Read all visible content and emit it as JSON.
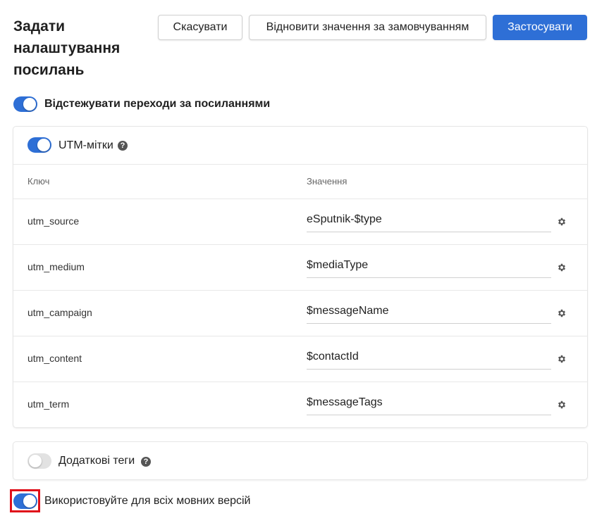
{
  "header": {
    "title": "Задати налаштування посилань",
    "buttons": {
      "cancel": "Скасувати",
      "restore_defaults": "Відновити значення за замовчуванням",
      "apply": "Застосувати"
    }
  },
  "track_clicks": {
    "label": "Відстежувати переходи за посиланнями",
    "enabled": true
  },
  "utm_section": {
    "label": "UTM-мітки",
    "enabled": true,
    "help_icon": "question-circle-icon",
    "columns": {
      "key": "Ключ",
      "value": "Значення"
    },
    "rows": [
      {
        "key": "utm_source",
        "value": "eSputnik-$type"
      },
      {
        "key": "utm_medium",
        "value": "$mediaType"
      },
      {
        "key": "utm_campaign",
        "value": "$messageName"
      },
      {
        "key": "utm_content",
        "value": "$contactId"
      },
      {
        "key": "utm_term",
        "value": "$messageTags"
      }
    ],
    "row_action_icon": "gear-icon"
  },
  "extra_tags": {
    "label": "Додаткові теги",
    "enabled": false,
    "help_icon": "question-circle-icon"
  },
  "all_languages": {
    "label": "Використовуйте для всіх мовних версій",
    "enabled": true
  },
  "colors": {
    "accent": "#2e6fd6",
    "highlight": "#e0101a",
    "switch_off": "#e2e2e2"
  }
}
